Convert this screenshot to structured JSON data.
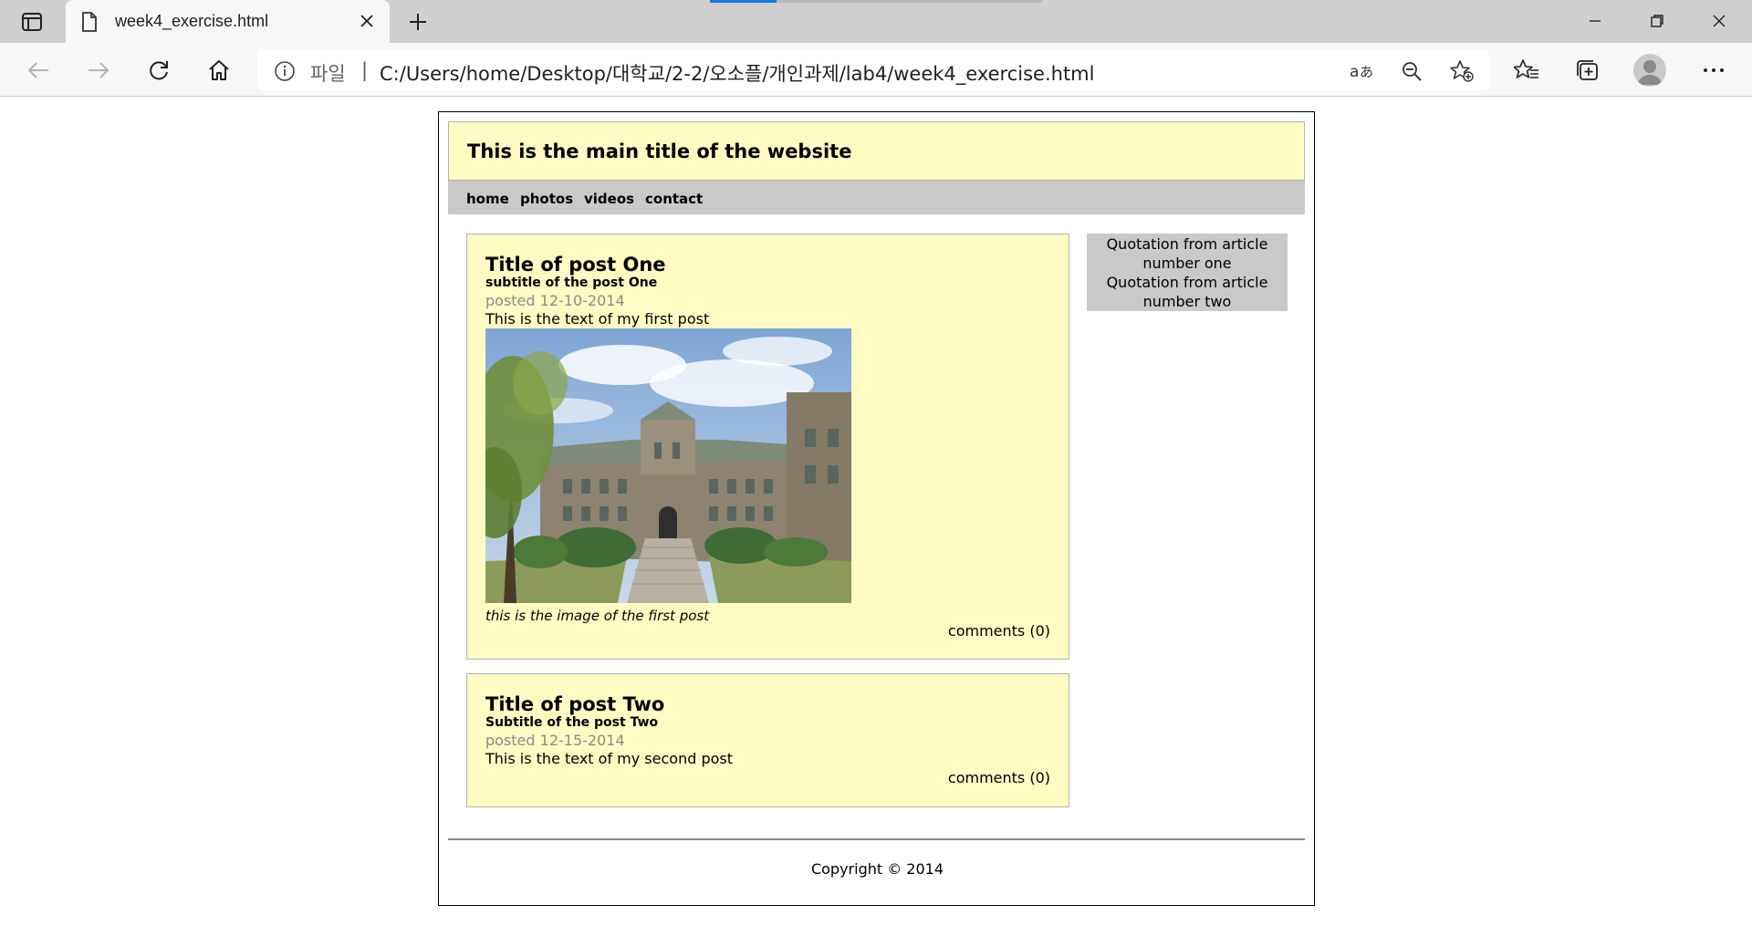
{
  "browser": {
    "tab_title": "week4_exercise.html",
    "address_scheme": "파일",
    "address_separator": "|",
    "address_url": "C:/Users/home/Desktop/대학교/2-2/오소플/개인과제/lab4/week4_exercise.html",
    "loading_progress": 0.2,
    "accent_color": "#1a73e8",
    "icons": [
      "tab-actions-icon",
      "file-icon",
      "close-icon",
      "plus-icon",
      "minimize-icon",
      "restore-icon",
      "close-window-icon",
      "back-arrow-icon",
      "forward-arrow-icon",
      "refresh-icon",
      "home-icon",
      "info-icon",
      "read-aloud-icon",
      "zoom-out-icon",
      "add-favorite-icon",
      "favorites-icon",
      "collections-icon",
      "profile-icon",
      "more-icon"
    ]
  },
  "site": {
    "header_bg": "#fffbc3",
    "menu_bg": "#c9c9c9",
    "title": "This is the main title of the website",
    "menu": [
      "home",
      "photos",
      "videos",
      "contact"
    ],
    "posts": [
      {
        "title": "Title of post One",
        "subtitle": "subtitle of the post One",
        "date": "posted 12-10-2014",
        "text": "This is the text of my first post",
        "image_alt": "campus building photo",
        "caption": "this is the image of the first post",
        "comments": "comments (0)"
      },
      {
        "title": "Title of post Two",
        "subtitle": "Subtitle of the post Two",
        "date": "posted 12-15-2014",
        "text": "This is the text of my second post",
        "comments": "comments (0)"
      }
    ],
    "aside": {
      "quote_one": "Quotation from article number one",
      "quote_two": "Quotation from article number two"
    },
    "footer": "Copyright © 2014"
  }
}
